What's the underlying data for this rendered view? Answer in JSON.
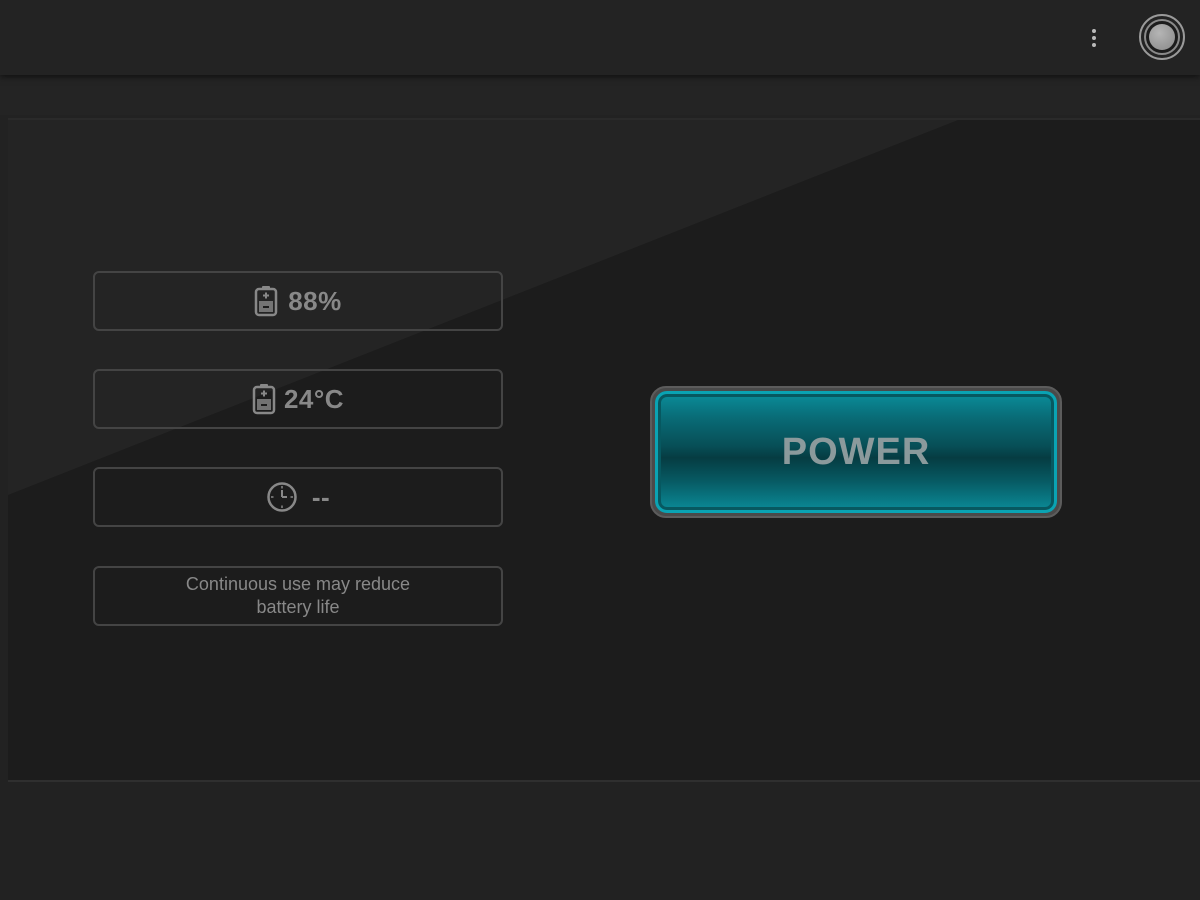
{
  "toolbar": {
    "menu_icon": "overflow-menu-icon",
    "toggle_icon": "power-toggle-icon"
  },
  "status": {
    "battery_level": "88%",
    "battery_temperature": "24°C",
    "time_remaining": "--",
    "warning": "Continuous use may reduce battery life",
    "icons": {
      "battery_level": "battery-icon",
      "battery_temperature": "battery-icon",
      "time_remaining": "clock-icon"
    }
  },
  "power_button": {
    "label": "POWER",
    "accent": "#0aa3b3"
  },
  "colors": {
    "background": "#222222",
    "panel": "#1c1c1c",
    "text": "#888888"
  }
}
